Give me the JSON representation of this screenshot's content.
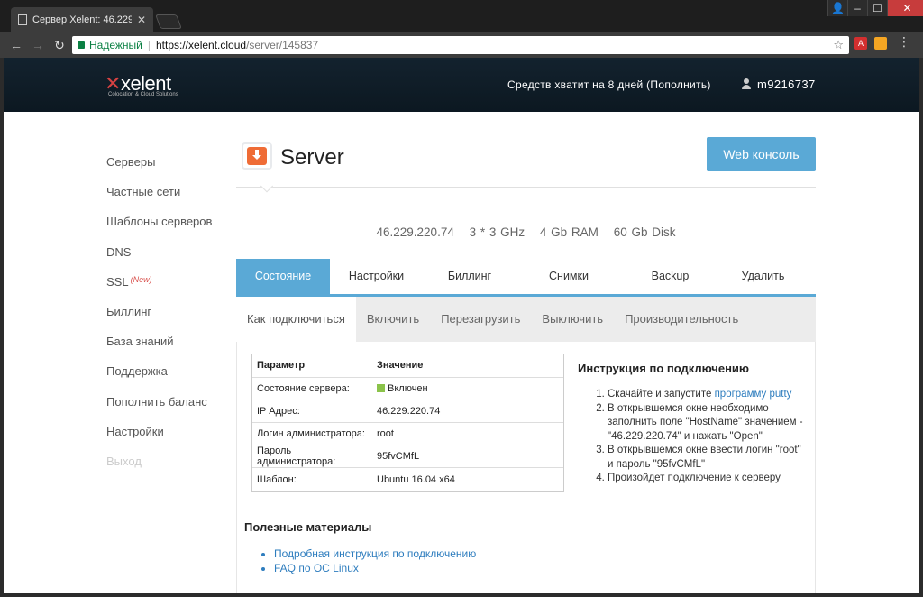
{
  "browser": {
    "tab_title": "Сервер Xelent: 46.229.22",
    "tab_close": "✕",
    "secure_label": "Надежный",
    "url_host": "https://xelent.cloud",
    "url_path": "/server/145837"
  },
  "site": {
    "logo_text": "xelent",
    "logo_subtitle": "Colocation & Cloud Solutions",
    "funds_text": "Средств хватит на 8 дней (Пополнить)",
    "username": "m9216737"
  },
  "sidebar": {
    "items": [
      {
        "label": "Серверы"
      },
      {
        "label": "Частные сети"
      },
      {
        "label": "Шаблоны серверов"
      },
      {
        "label": "DNS"
      },
      {
        "label": "SSL",
        "badge": "(New)"
      },
      {
        "label": "Биллинг"
      },
      {
        "label": "База знаний"
      },
      {
        "label": "Поддержка"
      },
      {
        "label": "Пополнить баланс"
      },
      {
        "label": "Настройки"
      },
      {
        "label": "Выход"
      }
    ]
  },
  "main": {
    "title": "Server",
    "web_console_label": "Web консоль",
    "specs": {
      "ip": "46.229.220.74",
      "cpu": "3 * 3 GHz",
      "ram": "4 Gb RAM",
      "disk": "60 Gb Disk"
    },
    "tabs": [
      "Состояние",
      "Настройки",
      "Биллинг",
      "Снимки",
      "Backup",
      "Удалить"
    ],
    "subtabs": [
      "Как подключиться",
      "Включить",
      "Перезагрузить",
      "Выключить",
      "Производительность"
    ],
    "table": {
      "head_param": "Параметр",
      "head_value": "Значение",
      "rows": [
        {
          "k": "Состояние сервера:",
          "v": "Включен"
        },
        {
          "k": "IP Адрес:",
          "v": "46.229.220.74"
        },
        {
          "k": "Логин администратора:",
          "v": "root"
        },
        {
          "k": "Пароль администратора:",
          "v": "95fvCMfL"
        },
        {
          "k": "Шаблон:",
          "v": "Ubuntu 16.04 x64"
        }
      ],
      "status_color": "#8bc34a"
    },
    "instructions": {
      "title": "Инструкция по подключению",
      "step1_prefix": "Скачайте и запустите ",
      "step1_link": "программу putty",
      "step2": "В открывшемся окне необходимо заполнить поле \"HostName\" значением - \"46.229.220.74\" и нажать \"Open\"",
      "step3": "В открывшемся окне ввести логин \"root\" и пароль \"95fvCMfL\"",
      "step4": "Произойдет подключение к серверу"
    },
    "useful": {
      "title": "Полезные материалы",
      "links": [
        "Подробная инструкция по подключению",
        "FAQ по ОС Linux"
      ]
    }
  },
  "colors": {
    "accent": "#5aa9d6",
    "header_bg": "#0f1c26",
    "link": "#2e7dbe",
    "brand_red": "#d64242"
  }
}
